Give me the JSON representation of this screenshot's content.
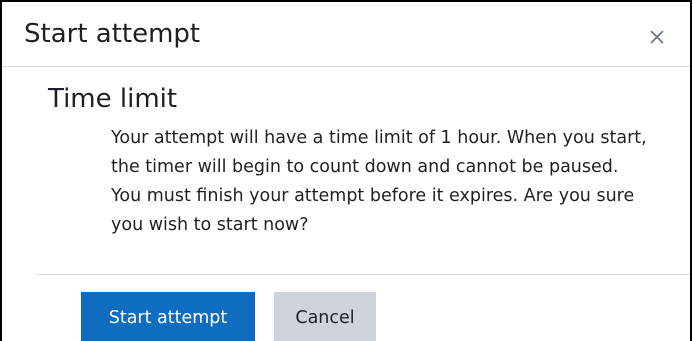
{
  "dialog": {
    "title": "Start attempt",
    "close_icon": "close-icon"
  },
  "section": {
    "title": "Time limit"
  },
  "message": {
    "lines": [
      "Your attempt will have a time limit of 1 hour. When you start,",
      "the timer will begin to count down and cannot be paused.",
      "You must finish your attempt before it expires. Are you sure",
      "you wish to start now?"
    ]
  },
  "buttons": {
    "start_label": "Start attempt",
    "cancel_label": "Cancel"
  },
  "colors": {
    "primary": "#0f6cbf",
    "secondary": "#ced4da",
    "text": "#1d2125",
    "divider": "#dee2e6"
  }
}
